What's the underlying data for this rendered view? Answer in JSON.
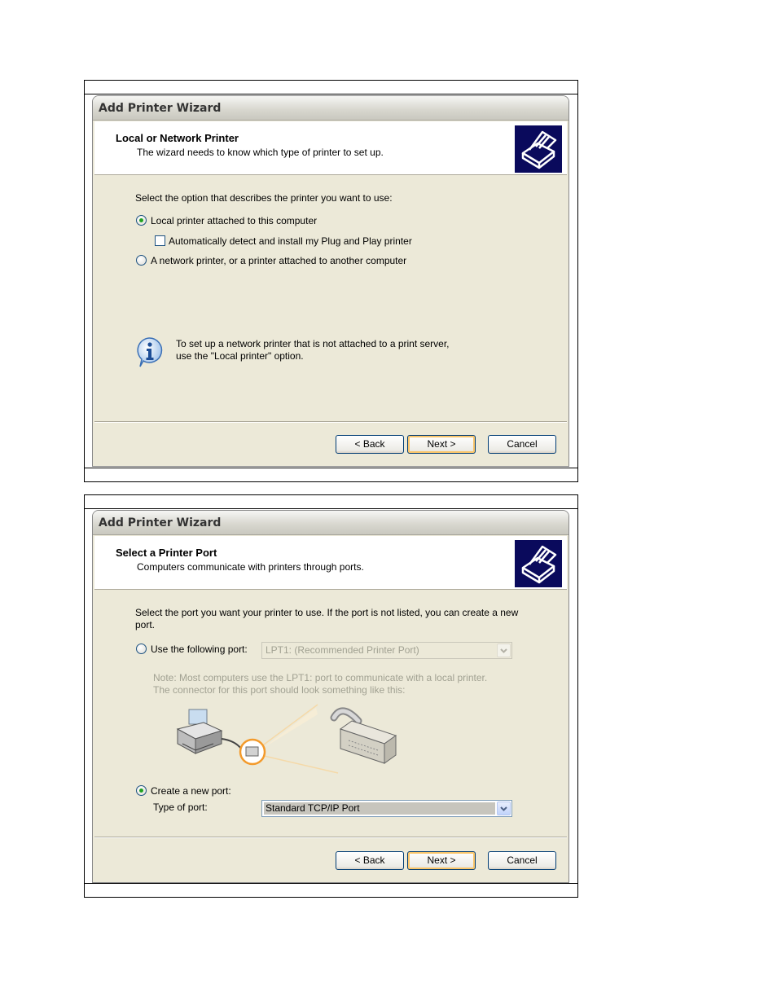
{
  "wizard1": {
    "title": "Add Printer Wizard",
    "header_title": "Local or Network Printer",
    "header_subtitle": "The wizard needs to know which type of printer to set up.",
    "prompt": "Select the option that describes the printer you want to use:",
    "option_local": "Local printer attached to this computer",
    "option_local_selected": true,
    "option_autodetect": "Automatically detect and install my Plug and Play printer",
    "option_autodetect_checked": false,
    "option_network": "A network printer, or a printer attached to another computer",
    "option_network_selected": false,
    "info_line1": "To set up a network printer that is not attached to a print server,",
    "info_line2": "use the \"Local printer\" option.",
    "back_label": "< Back",
    "next_label": "Next >",
    "cancel_label": "Cancel"
  },
  "wizard2": {
    "title": "Add Printer Wizard",
    "header_title": "Select a Printer Port",
    "header_subtitle": "Computers communicate with printers through ports.",
    "prompt": "Select the port you want your printer to use.  If the port is not listed, you can create a new port.",
    "option_use_port": "Use the following port:",
    "option_use_port_selected": false,
    "port_value": "LPT1: (Recommended Printer Port)",
    "note_line1": "Note: Most computers use the LPT1: port to communicate with a local printer.",
    "note_line2": "The connector for this port should look something like this:",
    "option_create_port": "Create a new port:",
    "option_create_port_selected": true,
    "type_of_port_label": "Type of port:",
    "type_of_port_value": "Standard TCP/IP Port",
    "back_label": "< Back",
    "next_label": "Next >",
    "cancel_label": "Cancel"
  },
  "icons": {
    "header_icon": "printer-wizard-icon",
    "info_icon": "info-icon",
    "illustration": "printer-cable-connector-illustration"
  },
  "colors": {
    "dialog_bg": "#ece9d8",
    "header_icon_bg": "#0a0a5c",
    "radio_dot": "#21a121",
    "default_button_highlight": "#f9c56a"
  }
}
